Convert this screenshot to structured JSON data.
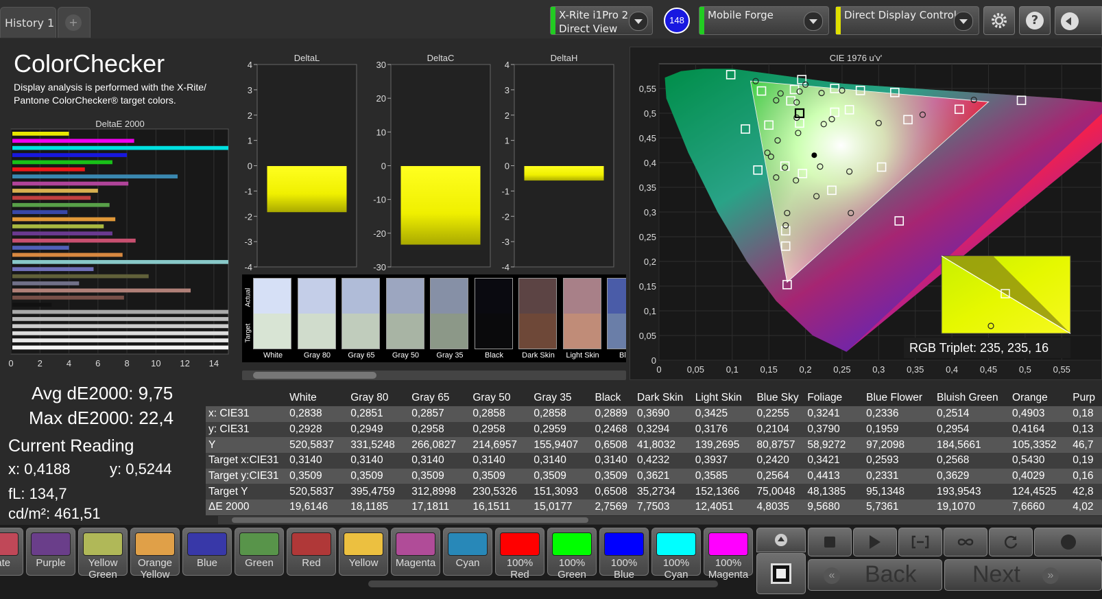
{
  "tabs": {
    "history": "History 1",
    "add": "+"
  },
  "device": {
    "line1": "X-Rite i1Pro 2",
    "line2": "Direct View",
    "badge": "148",
    "indicator_color": "#22cc22"
  },
  "display": {
    "label": "Mobile Forge",
    "indicator_color": "#22cc22"
  },
  "control": {
    "label": "Direct Display Control",
    "indicator_color": "#e0e000"
  },
  "toolbar": {
    "settings_icon": "gear-icon",
    "help_label": "?",
    "collapse_icon": "chevron-left-icon"
  },
  "title": "ColorChecker",
  "description_line1": "Display analysis is performed with the X-Rite/",
  "description_line2": "Pantone ColorChecker® target colors.",
  "de_chart": {
    "title": "DeltaE 2000",
    "ticks": [
      "0",
      "2",
      "4",
      "6",
      "8",
      "10",
      "12",
      "14"
    ],
    "xlim": [
      0,
      15
    ],
    "bars": [
      {
        "value": 4.0,
        "color": "#e8e800"
      },
      {
        "value": 8.5,
        "color": "#ee00ee"
      },
      {
        "value": 15.0,
        "color": "#00e0e0"
      },
      {
        "value": 8.0,
        "color": "#1818dd"
      },
      {
        "value": 7.0,
        "color": "#18c018"
      },
      {
        "value": 5.1,
        "color": "#ee1818"
      },
      {
        "value": 11.5,
        "color": "#3a88b0"
      },
      {
        "value": 8.1,
        "color": "#b0449a"
      },
      {
        "value": 6.0,
        "color": "#d8b050"
      },
      {
        "value": 5.5,
        "color": "#c04040"
      },
      {
        "value": 6.8,
        "color": "#58a048"
      },
      {
        "value": 3.9,
        "color": "#3848a8"
      },
      {
        "value": 7.2,
        "color": "#e09838"
      },
      {
        "value": 6.4,
        "color": "#a8b840"
      },
      {
        "value": 7.0,
        "color": "#6a3a90"
      },
      {
        "value": 8.6,
        "color": "#c85070"
      },
      {
        "value": 4.0,
        "color": "#5060b8"
      },
      {
        "value": 7.7,
        "color": "#d88840"
      },
      {
        "value": 15.0,
        "color": "#88c8c8"
      },
      {
        "value": 5.7,
        "color": "#7070b8"
      },
      {
        "value": 9.5,
        "color": "#60603a"
      },
      {
        "value": 4.7,
        "color": "#707088"
      },
      {
        "value": 12.4,
        "color": "#b08078"
      },
      {
        "value": 7.8,
        "color": "#785048"
      },
      {
        "value": 2.8,
        "color": "#111111"
      },
      {
        "value": 15.0,
        "color": "#aaaaaa"
      },
      {
        "value": 15.0,
        "color": "#bbbbbb"
      },
      {
        "value": 15.0,
        "color": "#cccccc"
      },
      {
        "value": 15.0,
        "color": "#dddddd"
      },
      {
        "value": 15.0,
        "color": "#e8e8e8"
      },
      {
        "value": 15.0,
        "color": "#f4f4f4"
      }
    ]
  },
  "delta_charts": [
    {
      "title": "DeltaL",
      "ticks": [
        "4",
        "3",
        "2",
        "1",
        "0",
        "-1",
        "-2",
        "-3",
        "-4"
      ],
      "ylim": [
        -4,
        4
      ],
      "value": -1.85
    },
    {
      "title": "DeltaC",
      "ticks": [
        "30",
        "20",
        "10",
        "0",
        "-10",
        "-20",
        "-30"
      ],
      "ylim": [
        -30,
        30
      ],
      "value": -23.5
    },
    {
      "title": "DeltaH",
      "ticks": [
        "4",
        "3",
        "2",
        "1",
        "0",
        "-1",
        "-2",
        "-3",
        "-4"
      ],
      "ylim": [
        -4,
        4
      ],
      "value": -0.6
    }
  ],
  "patch_labels": {
    "actual": "Actual",
    "target": "Target"
  },
  "patches": [
    {
      "name": "White",
      "actual": "#d6e0f6",
      "target": "#d8e4d4"
    },
    {
      "name": "Gray 80",
      "actual": "#c4cee8",
      "target": "#d0dccc"
    },
    {
      "name": "Gray 65",
      "actual": "#b0bcd8",
      "target": "#c0ccbc"
    },
    {
      "name": "Gray 50",
      "actual": "#9ca6c0",
      "target": "#a8b4a4"
    },
    {
      "name": "Gray 35",
      "actual": "#8690a6",
      "target": "#8c9888"
    },
    {
      "name": "Black",
      "actual": "#0a0a10",
      "target": "#0a0a0c"
    },
    {
      "name": "Dark Skin",
      "actual": "#5c4444",
      "target": "#6e4838"
    },
    {
      "name": "Light Skin",
      "actual": "#a88088",
      "target": "#c08c78"
    },
    {
      "name": "Blue",
      "actual": "#4a5ca8",
      "target": "#6a7ea8"
    }
  ],
  "cie": {
    "title": "CIE 1976 u'v'",
    "xticks": [
      "0",
      "0,05",
      "0,1",
      "0,15",
      "0,2",
      "0,25",
      "0,3",
      "0,35",
      "0,4",
      "0,45",
      "0,5",
      "0,55"
    ],
    "yticks": [
      "0,55",
      "0,5",
      "0,45",
      "0,4",
      "0,35",
      "0,3",
      "0,25",
      "0,2",
      "0,15",
      "0,1",
      "0,05",
      "0"
    ],
    "targets": [
      [
        0.098,
        0.578
      ],
      [
        0.195,
        0.568
      ],
      [
        0.14,
        0.545
      ],
      [
        0.185,
        0.548
      ],
      [
        0.24,
        0.55
      ],
      [
        0.275,
        0.546
      ],
      [
        0.322,
        0.542
      ],
      [
        0.18,
        0.525
      ],
      [
        0.192,
        0.48
      ],
      [
        0.24,
        0.502
      ],
      [
        0.26,
        0.507
      ],
      [
        0.34,
        0.487
      ],
      [
        0.41,
        0.508
      ],
      [
        0.495,
        0.526
      ],
      [
        0.118,
        0.468
      ],
      [
        0.15,
        0.476
      ],
      [
        0.135,
        0.385
      ],
      [
        0.172,
        0.393
      ],
      [
        0.196,
        0.378
      ],
      [
        0.236,
        0.344
      ],
      [
        0.304,
        0.391
      ],
      [
        0.328,
        0.282
      ],
      [
        0.173,
        0.262
      ],
      [
        0.173,
        0.231
      ],
      [
        0.175,
        0.153
      ]
    ],
    "measured": [
      [
        0.132,
        0.565
      ],
      [
        0.2,
        0.558
      ],
      [
        0.192,
        0.544
      ],
      [
        0.166,
        0.54
      ],
      [
        0.16,
        0.526
      ],
      [
        0.25,
        0.546
      ],
      [
        0.222,
        0.541
      ],
      [
        0.188,
        0.522
      ],
      [
        0.188,
        0.491
      ],
      [
        0.236,
        0.488
      ],
      [
        0.3,
        0.48
      ],
      [
        0.36,
        0.497
      ],
      [
        0.43,
        0.527
      ],
      [
        0.225,
        0.478
      ],
      [
        0.19,
        0.46
      ],
      [
        0.162,
        0.445
      ],
      [
        0.148,
        0.42
      ],
      [
        0.153,
        0.412
      ],
      [
        0.22,
        0.392
      ],
      [
        0.172,
        0.39
      ],
      [
        0.16,
        0.37
      ],
      [
        0.187,
        0.364
      ],
      [
        0.26,
        0.382
      ],
      [
        0.215,
        0.332
      ],
      [
        0.175,
        0.298
      ],
      [
        0.173,
        0.273
      ],
      [
        0.262,
        0.298
      ]
    ],
    "current": [
      0.192,
      0.5
    ],
    "current_black": [
      0.212,
      0.415
    ],
    "inset_label": "RGB Triplet: 235, 235, 16"
  },
  "stats": {
    "avg": "Avg dE2000: 9,75",
    "max": "Max dE2000: 22,4",
    "current_title": "Current Reading",
    "x": "x: 0,4188",
    "y": "y: 0,5244",
    "fl": "fL: 134,7",
    "cdm2": "cd/m²: 461,51"
  },
  "table": {
    "columns": [
      "White",
      "Gray 80",
      "Gray 65",
      "Gray 50",
      "Gray 35",
      "Black",
      "Dark Skin",
      "Light Skin",
      "Blue Sky",
      "Foliage",
      "Blue Flower",
      "Bluish Green",
      "Orange",
      "Purp"
    ],
    "rows": [
      {
        "label": "x: CIE31",
        "cells": [
          "0,2838",
          "0,2851",
          "0,2857",
          "0,2858",
          "0,2858",
          "0,2889",
          "0,3690",
          "0,3425",
          "0,2255",
          "0,3241",
          "0,2336",
          "0,2514",
          "0,4903",
          "0,18"
        ]
      },
      {
        "label": "y: CIE31",
        "cells": [
          "0,2928",
          "0,2949",
          "0,2958",
          "0,2958",
          "0,2959",
          "0,2468",
          "0,3294",
          "0,3176",
          "0,2104",
          "0,3790",
          "0,1959",
          "0,2954",
          "0,4164",
          "0,13"
        ]
      },
      {
        "label": "Y",
        "cells": [
          "520,5837",
          "331,5248",
          "266,0827",
          "214,6957",
          "155,9407",
          "0,6508",
          "41,8032",
          "139,2695",
          "80,8757",
          "58,9272",
          "97,2098",
          "184,5661",
          "105,3352",
          "46,7"
        ]
      },
      {
        "label": "Target x:CIE31",
        "cells": [
          "0,3140",
          "0,3140",
          "0,3140",
          "0,3140",
          "0,3140",
          "0,3140",
          "0,4232",
          "0,3937",
          "0,2420",
          "0,3421",
          "0,2593",
          "0,2568",
          "0,5430",
          "0,19"
        ]
      },
      {
        "label": "Target y:CIE31",
        "cells": [
          "0,3509",
          "0,3509",
          "0,3509",
          "0,3509",
          "0,3509",
          "0,3509",
          "0,3621",
          "0,3585",
          "0,2564",
          "0,4413",
          "0,2331",
          "0,3629",
          "0,4029",
          "0,16"
        ]
      },
      {
        "label": "Target Y",
        "cells": [
          "520,5837",
          "395,4759",
          "312,8998",
          "230,5326",
          "151,3093",
          "0,6508",
          "35,2734",
          "152,1366",
          "75,0048",
          "48,1385",
          "95,1348",
          "193,9543",
          "124,4525",
          "42,8"
        ]
      },
      {
        "label": "ΔE 2000",
        "cells": [
          "19,6146",
          "18,1185",
          "17,1811",
          "16,1511",
          "15,0177",
          "2,7569",
          "7,7503",
          "12,4051",
          "4,8035",
          "9,5680",
          "5,7361",
          "19,1070",
          "7,6660",
          "4,02"
        ]
      }
    ]
  },
  "swatches": [
    {
      "label": "erate",
      "color": "#c04858"
    },
    {
      "label": "Purple",
      "color": "#6a3e8a"
    },
    {
      "label": "Yellow Green",
      "color": "#b0b858"
    },
    {
      "label": "Orange Yellow",
      "color": "#e0a048"
    },
    {
      "label": "Blue",
      "color": "#3838a8"
    },
    {
      "label": "Green",
      "color": "#58944a"
    },
    {
      "label": "Red",
      "color": "#b03838"
    },
    {
      "label": "Yellow",
      "color": "#ecc040"
    },
    {
      "label": "Magenta",
      "color": "#b04c98"
    },
    {
      "label": "Cyan",
      "color": "#2888b8"
    },
    {
      "label": "100% Red",
      "color": "#ff0000"
    },
    {
      "label": "100% Green",
      "color": "#00ff00"
    },
    {
      "label": "100% Blue",
      "color": "#0000ff"
    },
    {
      "label": "100% Cyan",
      "color": "#00ffff"
    },
    {
      "label": "100% Magenta",
      "color": "#ff00ff"
    }
  ],
  "nav": {
    "back": "Back",
    "next": "Next"
  }
}
